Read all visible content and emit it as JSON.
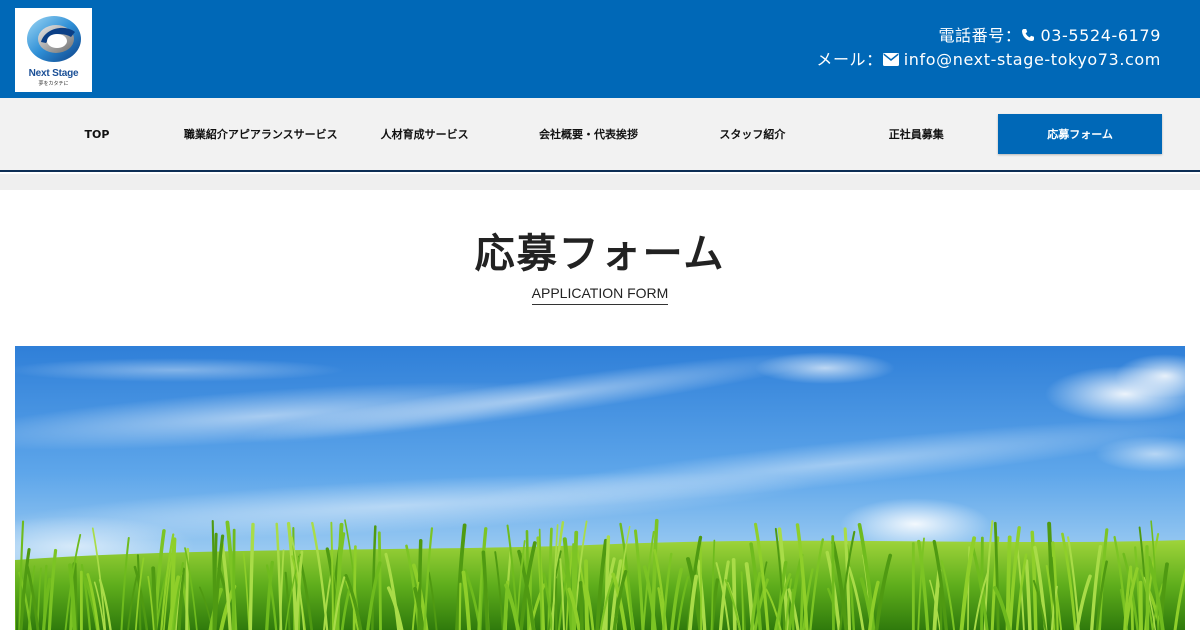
{
  "header": {
    "logo": {
      "name": "Next Stage",
      "tagline": "夢をカタチに"
    },
    "contact": {
      "phone_label": "電話番号：",
      "phone": "03-5524-6179",
      "phone_icon": "phone-icon",
      "mail_label": "メール：",
      "email": "info@next-stage-tokyo73.com",
      "mail_icon": "envelope-icon"
    },
    "colors": {
      "header_bg": "#0068b7",
      "nav_active_bg": "#0068b7",
      "nav_border": "#0d2e55"
    }
  },
  "nav": {
    "items": [
      {
        "label": "TOP",
        "active": false
      },
      {
        "label": "職業紹介アピアランスサービス",
        "active": false
      },
      {
        "label": "人材育成サービス",
        "active": false
      },
      {
        "label": "会社概要・代表挨拶",
        "active": false
      },
      {
        "label": "スタッフ紹介",
        "active": false
      },
      {
        "label": "正社員募集",
        "active": false
      },
      {
        "label": "応募フォーム",
        "active": true
      }
    ]
  },
  "main": {
    "title": "応募フォーム",
    "subtitle": "APPLICATION FORM",
    "hero_image": "blue-sky-and-green-grass-photo"
  }
}
